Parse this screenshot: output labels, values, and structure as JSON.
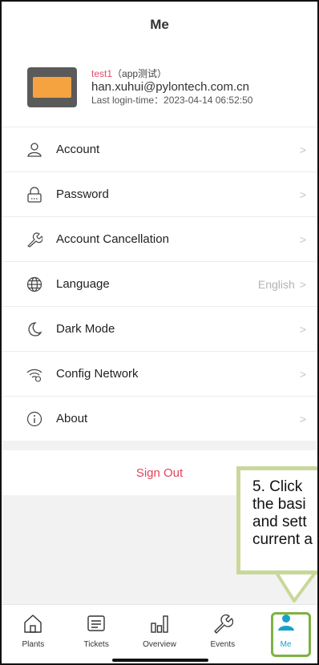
{
  "header": {
    "title": "Me"
  },
  "profile": {
    "username": "test1",
    "username_suffix": "（app测试）",
    "email": "han.xuhui@pylontech.com.cn",
    "last_login": "Last login-time：2023-04-14 06:52:50"
  },
  "menu": {
    "items": [
      {
        "label": "Account",
        "icon": "person-icon"
      },
      {
        "label": "Password",
        "icon": "lock-icon"
      },
      {
        "label": "Account Cancellation",
        "icon": "wrench-icon"
      },
      {
        "label": "Language",
        "value": "English",
        "icon": "globe-icon"
      },
      {
        "label": "Dark Mode",
        "icon": "moon-icon"
      },
      {
        "label": "Config Network",
        "icon": "wifi-icon"
      },
      {
        "label": "About",
        "icon": "info-icon"
      }
    ],
    "chevron": ">"
  },
  "signout": {
    "label": "Sign Out"
  },
  "callout": {
    "text": "5. Click \nthe basi\nand sett\ncurrent a"
  },
  "tabbar": {
    "tabs": [
      {
        "label": "Plants",
        "icon": "home-icon"
      },
      {
        "label": "Tickets",
        "icon": "tickets-icon"
      },
      {
        "label": "Overview",
        "icon": "bar-chart-icon"
      },
      {
        "label": "Events",
        "icon": "wrench-icon"
      },
      {
        "label": "Me",
        "icon": "person-icon",
        "active": true
      }
    ]
  },
  "colors": {
    "accent": "#1aa0c8",
    "danger": "#e0455c",
    "highlight": "#7cb342",
    "callout_border": "#c9d89a"
  }
}
